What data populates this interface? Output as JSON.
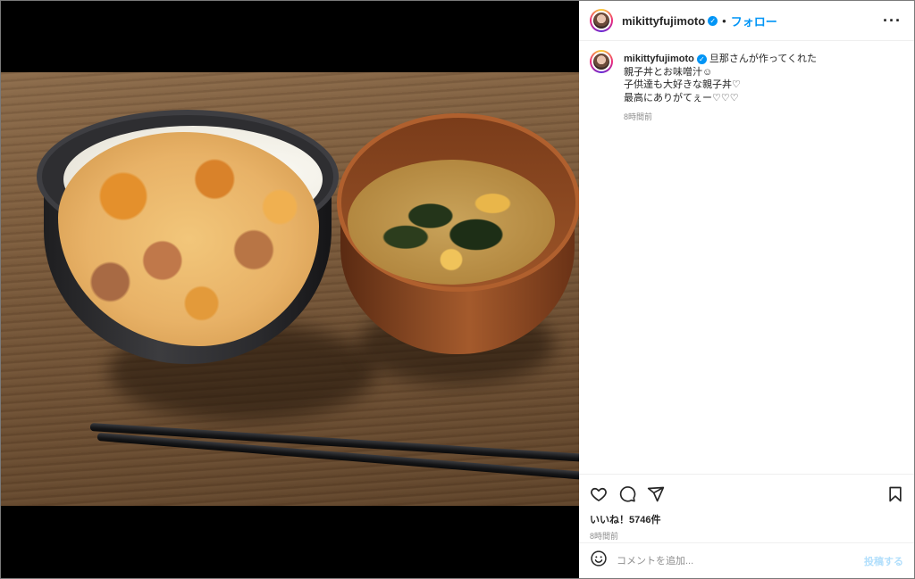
{
  "post": {
    "username": "mikittyfujimoto",
    "verified_mark": "✓",
    "separator": "•",
    "follow_label": "フォロー",
    "more_label": "···"
  },
  "caption": {
    "username": "mikittyfujimoto",
    "lines": [
      "旦那さんが作ってくれた",
      "親子丼とお味噌汁☺",
      "子供達も大好きな親子丼♡",
      "最高にありがてぇー♡♡♡"
    ],
    "time": "8時間前"
  },
  "actions": {
    "likes": "いいね！5746件",
    "time": "8時間前"
  },
  "comment": {
    "placeholder": "コメントを追加...",
    "post_label": "投稿する"
  },
  "icons": {
    "like": "heart-icon",
    "comment": "comment-icon",
    "share": "share-icon",
    "save": "bookmark-icon",
    "emoji": "emoji-icon"
  },
  "colors": {
    "accent": "#0095f6",
    "text": "#262626",
    "muted": "#8e8e8e",
    "border": "#efefef"
  }
}
